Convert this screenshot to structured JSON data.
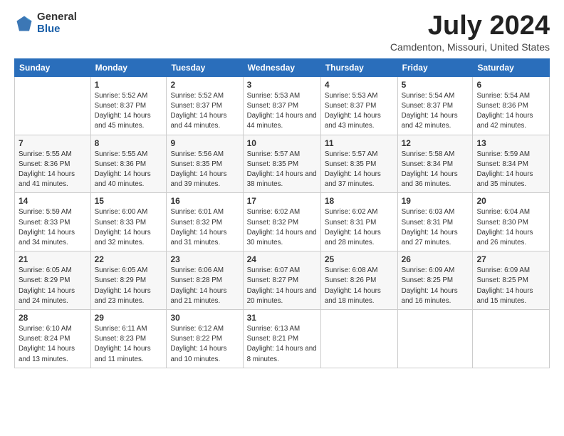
{
  "logo": {
    "general": "General",
    "blue": "Blue"
  },
  "title": "July 2024",
  "subtitle": "Camdenton, Missouri, United States",
  "header_days": [
    "Sunday",
    "Monday",
    "Tuesday",
    "Wednesday",
    "Thursday",
    "Friday",
    "Saturday"
  ],
  "weeks": [
    [
      {
        "day": "",
        "sunrise": "",
        "sunset": "",
        "daylight": ""
      },
      {
        "day": "1",
        "sunrise": "Sunrise: 5:52 AM",
        "sunset": "Sunset: 8:37 PM",
        "daylight": "Daylight: 14 hours and 45 minutes."
      },
      {
        "day": "2",
        "sunrise": "Sunrise: 5:52 AM",
        "sunset": "Sunset: 8:37 PM",
        "daylight": "Daylight: 14 hours and 44 minutes."
      },
      {
        "day": "3",
        "sunrise": "Sunrise: 5:53 AM",
        "sunset": "Sunset: 8:37 PM",
        "daylight": "Daylight: 14 hours and 44 minutes."
      },
      {
        "day": "4",
        "sunrise": "Sunrise: 5:53 AM",
        "sunset": "Sunset: 8:37 PM",
        "daylight": "Daylight: 14 hours and 43 minutes."
      },
      {
        "day": "5",
        "sunrise": "Sunrise: 5:54 AM",
        "sunset": "Sunset: 8:37 PM",
        "daylight": "Daylight: 14 hours and 42 minutes."
      },
      {
        "day": "6",
        "sunrise": "Sunrise: 5:54 AM",
        "sunset": "Sunset: 8:36 PM",
        "daylight": "Daylight: 14 hours and 42 minutes."
      }
    ],
    [
      {
        "day": "7",
        "sunrise": "Sunrise: 5:55 AM",
        "sunset": "Sunset: 8:36 PM",
        "daylight": "Daylight: 14 hours and 41 minutes."
      },
      {
        "day": "8",
        "sunrise": "Sunrise: 5:55 AM",
        "sunset": "Sunset: 8:36 PM",
        "daylight": "Daylight: 14 hours and 40 minutes."
      },
      {
        "day": "9",
        "sunrise": "Sunrise: 5:56 AM",
        "sunset": "Sunset: 8:35 PM",
        "daylight": "Daylight: 14 hours and 39 minutes."
      },
      {
        "day": "10",
        "sunrise": "Sunrise: 5:57 AM",
        "sunset": "Sunset: 8:35 PM",
        "daylight": "Daylight: 14 hours and 38 minutes."
      },
      {
        "day": "11",
        "sunrise": "Sunrise: 5:57 AM",
        "sunset": "Sunset: 8:35 PM",
        "daylight": "Daylight: 14 hours and 37 minutes."
      },
      {
        "day": "12",
        "sunrise": "Sunrise: 5:58 AM",
        "sunset": "Sunset: 8:34 PM",
        "daylight": "Daylight: 14 hours and 36 minutes."
      },
      {
        "day": "13",
        "sunrise": "Sunrise: 5:59 AM",
        "sunset": "Sunset: 8:34 PM",
        "daylight": "Daylight: 14 hours and 35 minutes."
      }
    ],
    [
      {
        "day": "14",
        "sunrise": "Sunrise: 5:59 AM",
        "sunset": "Sunset: 8:33 PM",
        "daylight": "Daylight: 14 hours and 34 minutes."
      },
      {
        "day": "15",
        "sunrise": "Sunrise: 6:00 AM",
        "sunset": "Sunset: 8:33 PM",
        "daylight": "Daylight: 14 hours and 32 minutes."
      },
      {
        "day": "16",
        "sunrise": "Sunrise: 6:01 AM",
        "sunset": "Sunset: 8:32 PM",
        "daylight": "Daylight: 14 hours and 31 minutes."
      },
      {
        "day": "17",
        "sunrise": "Sunrise: 6:02 AM",
        "sunset": "Sunset: 8:32 PM",
        "daylight": "Daylight: 14 hours and 30 minutes."
      },
      {
        "day": "18",
        "sunrise": "Sunrise: 6:02 AM",
        "sunset": "Sunset: 8:31 PM",
        "daylight": "Daylight: 14 hours and 28 minutes."
      },
      {
        "day": "19",
        "sunrise": "Sunrise: 6:03 AM",
        "sunset": "Sunset: 8:31 PM",
        "daylight": "Daylight: 14 hours and 27 minutes."
      },
      {
        "day": "20",
        "sunrise": "Sunrise: 6:04 AM",
        "sunset": "Sunset: 8:30 PM",
        "daylight": "Daylight: 14 hours and 26 minutes."
      }
    ],
    [
      {
        "day": "21",
        "sunrise": "Sunrise: 6:05 AM",
        "sunset": "Sunset: 8:29 PM",
        "daylight": "Daylight: 14 hours and 24 minutes."
      },
      {
        "day": "22",
        "sunrise": "Sunrise: 6:05 AM",
        "sunset": "Sunset: 8:29 PM",
        "daylight": "Daylight: 14 hours and 23 minutes."
      },
      {
        "day": "23",
        "sunrise": "Sunrise: 6:06 AM",
        "sunset": "Sunset: 8:28 PM",
        "daylight": "Daylight: 14 hours and 21 minutes."
      },
      {
        "day": "24",
        "sunrise": "Sunrise: 6:07 AM",
        "sunset": "Sunset: 8:27 PM",
        "daylight": "Daylight: 14 hours and 20 minutes."
      },
      {
        "day": "25",
        "sunrise": "Sunrise: 6:08 AM",
        "sunset": "Sunset: 8:26 PM",
        "daylight": "Daylight: 14 hours and 18 minutes."
      },
      {
        "day": "26",
        "sunrise": "Sunrise: 6:09 AM",
        "sunset": "Sunset: 8:25 PM",
        "daylight": "Daylight: 14 hours and 16 minutes."
      },
      {
        "day": "27",
        "sunrise": "Sunrise: 6:09 AM",
        "sunset": "Sunset: 8:25 PM",
        "daylight": "Daylight: 14 hours and 15 minutes."
      }
    ],
    [
      {
        "day": "28",
        "sunrise": "Sunrise: 6:10 AM",
        "sunset": "Sunset: 8:24 PM",
        "daylight": "Daylight: 14 hours and 13 minutes."
      },
      {
        "day": "29",
        "sunrise": "Sunrise: 6:11 AM",
        "sunset": "Sunset: 8:23 PM",
        "daylight": "Daylight: 14 hours and 11 minutes."
      },
      {
        "day": "30",
        "sunrise": "Sunrise: 6:12 AM",
        "sunset": "Sunset: 8:22 PM",
        "daylight": "Daylight: 14 hours and 10 minutes."
      },
      {
        "day": "31",
        "sunrise": "Sunrise: 6:13 AM",
        "sunset": "Sunset: 8:21 PM",
        "daylight": "Daylight: 14 hours and 8 minutes."
      },
      {
        "day": "",
        "sunrise": "",
        "sunset": "",
        "daylight": ""
      },
      {
        "day": "",
        "sunrise": "",
        "sunset": "",
        "daylight": ""
      },
      {
        "day": "",
        "sunrise": "",
        "sunset": "",
        "daylight": ""
      }
    ]
  ]
}
